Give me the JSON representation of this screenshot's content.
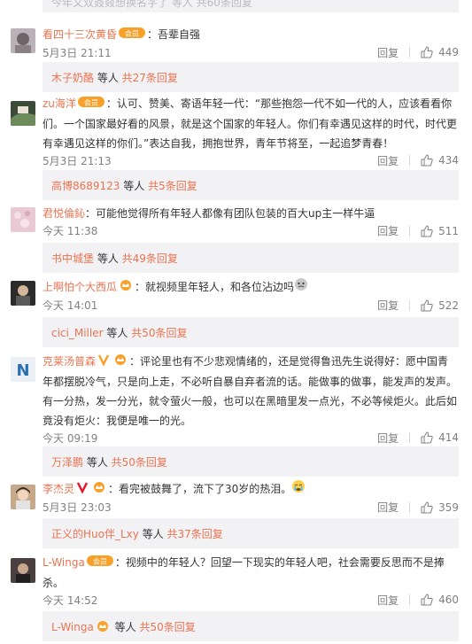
{
  "top_strip_text": "今年又双叒叕想换名字了 等人 共60条回复",
  "comments": [
    {
      "user": "看四十三次黄昏",
      "text": "：吾辈自强",
      "time": "5月3日 21:11",
      "reply_label": "回复",
      "likes": "449",
      "sub": {
        "user": "木子奶酪",
        "mid": " 等人 ",
        "count": "共27条回复"
      }
    },
    {
      "user": "zu海洋",
      "text": "：认可、赞美、寄语年轻一代：“那些抱怨一代不如一代的人，应该看看你们。一个国家最好看的风景，就是这个国家的年轻人。你们有幸遇见这样的时代，时代更有幸遇见这样的你们。”表达自我，拥抱世界，青年节将至，一起追梦青春！",
      "time": "5月3日 21:13",
      "reply_label": "回复",
      "likes": "434",
      "sub": {
        "user": "高博8689123",
        "mid": " 等人 ",
        "count": "共5条回复"
      }
    },
    {
      "user": "君悦倫鈊",
      "text": "：可能他觉得所有年轻人都像有团队包装的百大up主一样牛逼",
      "time": "今天 11:38",
      "reply_label": "回复",
      "likes": "511",
      "sub": {
        "user": "书中城堡",
        "mid": " 等人 ",
        "count": "共49条回复"
      }
    },
    {
      "user": "上啊怕个大西瓜",
      "text": "：就视频里年轻人，和各位沾边吗",
      "time": "今天 14:01",
      "reply_label": "回复",
      "likes": "522",
      "sub": {
        "user": "cici_Miller",
        "mid": " 等人 ",
        "count": "共50条回复"
      }
    },
    {
      "user": "克莱汤普森",
      "text": "：评论里也有不少悲观情绪的，还是觉得鲁迅先生说得好：愿中国青年都摆脱冷气，只是向上走，不必听自暴自弃者流的话。能做事的做事，能发声的发声。有一分热，发一分光，就令萤火一般，也可以在黑暗里发一点光，不必等候炬火。此后如竟没有炬火：我便是唯一的光。",
      "time": "今天 09:19",
      "reply_label": "回复",
      "likes": "414",
      "sub": {
        "user": "万泽鹏",
        "mid": " 等人 ",
        "count": "共50条回复"
      }
    },
    {
      "user": "李杰灵",
      "text": "：看完被鼓舞了，流下了30岁的热泪。",
      "time": "5月3日 23:03",
      "reply_label": "回复",
      "likes": "359",
      "sub": {
        "user": "正义的Huo伴_Lxy",
        "mid": " 等人 ",
        "count": "共37条回复"
      }
    },
    {
      "user": "L-Winga",
      "text": "：视频中的年轻人？回望一下现实的年轻人吧，社会需要反思而不是捧杀。",
      "time": "今天 14:52",
      "reply_label": "回复",
      "likes": "460",
      "sub": {
        "user": "L-Winga",
        "mid": " 等人 ",
        "count": "共50条回复"
      }
    }
  ],
  "badge_text": "会员",
  "colors": {
    "link": "#eb7350",
    "meta": "#808080",
    "sub_bg": "#f2f2f5",
    "badge": "#f7a12b"
  }
}
